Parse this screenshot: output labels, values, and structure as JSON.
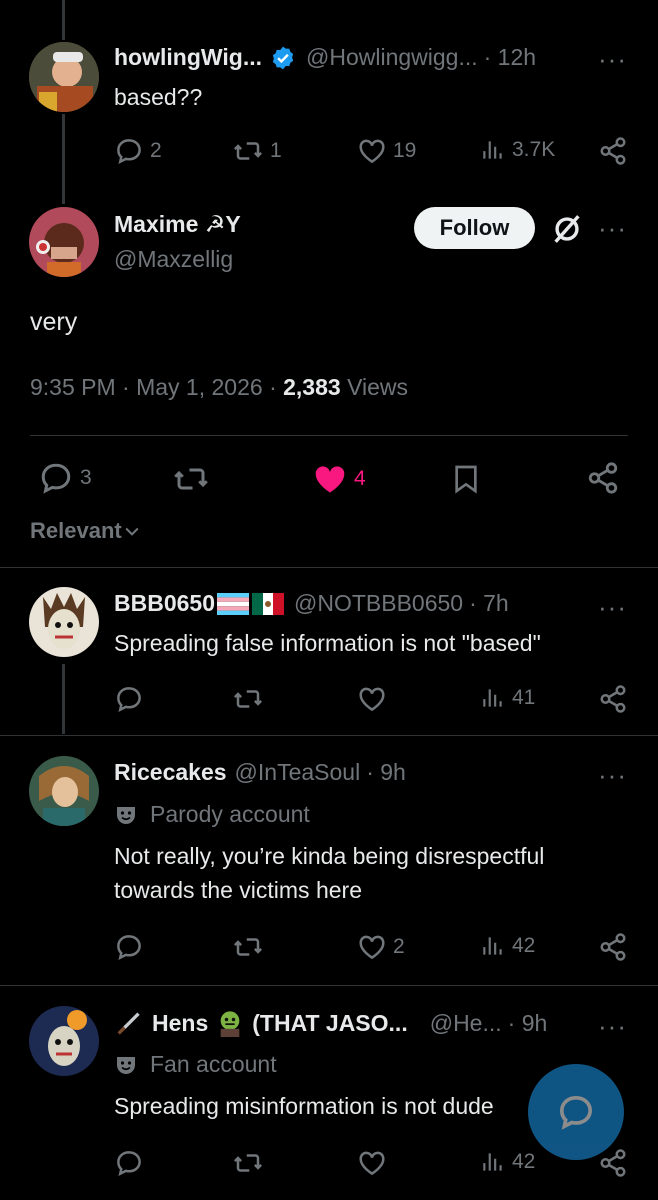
{
  "tweets": [
    {
      "name": "howlingWig...",
      "handle": "@Howlingwigg...",
      "time": "· 12h",
      "text": "based??",
      "replies": "2",
      "reposts": "1",
      "likes": "19",
      "views": "3.7K"
    }
  ],
  "main": {
    "name": "Maxime ☭Υ",
    "handle": "@Maxzellig",
    "follow_label": "Follow",
    "text": "very",
    "timestamp": "9:35 PM · May 1, 2026 · ",
    "views_count": "2,383",
    "views_label": " Views",
    "replies": "3",
    "likes": "4",
    "like_color": "#f91880"
  },
  "sort_label": "Relevant",
  "replies": [
    {
      "name": "BBB0650",
      "handle": "@NOTBBB0650",
      "time": "· 7h",
      "text": "Spreading false information is not \"based\"",
      "views": "41"
    },
    {
      "name": "Ricecakes",
      "handle": "@InTeaSoul",
      "time": "· 9h",
      "label": "Parody account",
      "text_line1": "Not really, you’re kinda being disrespectful",
      "text_line2": "towards the victims here",
      "likes": "2",
      "views": "42"
    },
    {
      "name": "Hens",
      "name_suffix": "(THAT JASO...",
      "handle": "@He...",
      "time": "· 9h",
      "label": "Fan account",
      "text": "Spreading misinformation is not dude",
      "views": "42"
    }
  ],
  "colors": {
    "accent": "#1d9bf0",
    "background": "#000000",
    "muted": "#71767b"
  }
}
